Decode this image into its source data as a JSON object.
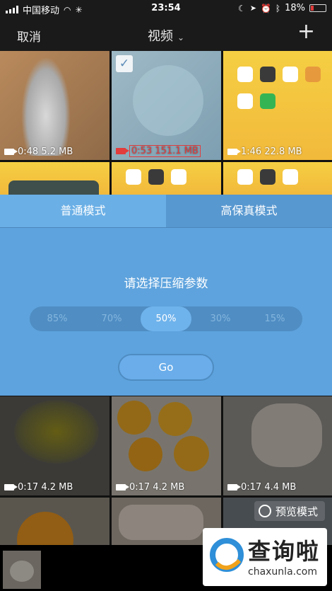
{
  "status_bar": {
    "carrier": "中国移动",
    "time": "23:54",
    "battery": "18%",
    "battery_level": 0.18
  },
  "nav": {
    "cancel_label": "取消",
    "title": "视频",
    "add_label": "+"
  },
  "tiles": [
    {
      "duration": "0:48",
      "size": "5.2 MB",
      "selected": false
    },
    {
      "duration": "0:53",
      "size": "151.1 MB",
      "selected": true
    },
    {
      "duration": "1:46",
      "size": "22.8 MB",
      "selected": false
    },
    {
      "duration": "0:17",
      "size": "4.2 MB",
      "selected": false
    },
    {
      "duration": "0:17",
      "size": "4.2 MB",
      "selected": false
    },
    {
      "duration": "0:17",
      "size": "4.4 MB",
      "selected": false
    }
  ],
  "modal": {
    "tabs": [
      "普通模式",
      "高保真模式"
    ],
    "active_tab": 0,
    "title": "请选择压缩参数",
    "options": [
      "85%",
      "70%",
      "50%",
      "30%",
      "15%"
    ],
    "selected_option": "50%",
    "go_label": "Go"
  },
  "preview_mode_label": "预览模式",
  "watermark": {
    "brand": "查询啦",
    "url": "chaxunla.com"
  },
  "colors": {
    "modal_bg": "#5ea3dd",
    "active_tab": "#6aafe6",
    "segment_bg": "#4f8dc3",
    "warning_red": "#e23c3c"
  }
}
